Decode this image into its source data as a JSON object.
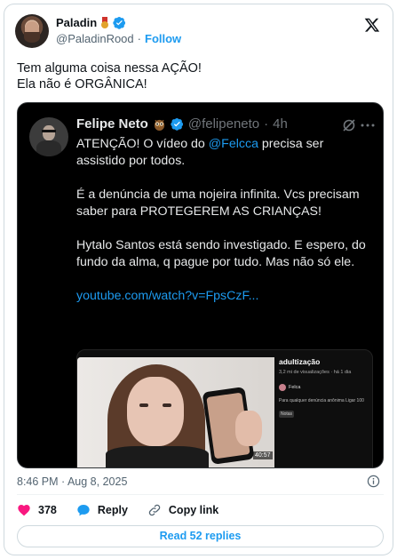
{
  "author": {
    "name": "Paladin",
    "handle": "@PaladinRood",
    "separator": "·",
    "follow_label": "Follow"
  },
  "tweet": {
    "line1": "Tem alguma coisa nessa AÇÃO!",
    "line2": "Ela não é ORGÂNICA!"
  },
  "quoted": {
    "name": "Felipe Neto",
    "handle": "@felipeneto",
    "separator": "·",
    "age": "4h",
    "p1_prefix": "ATENÇÃO! O vídeo do ",
    "p1_mention": "@Felcca",
    "p1_suffix": " precisa ser assistido por todos.",
    "p2": "É a denúncia de uma nojeira infinita. Vcs precisam saber para PROTEGEREM AS CRIANÇAS!",
    "p3": "Hytalo Santos está sendo investigado. E espero, do fundo da alma, q pague por tudo. Mas não só ele.",
    "link": "youtube.com/watch?v=FpsCzF...",
    "video": {
      "duration": "40:57",
      "title": "adultização",
      "views": "3,2 mi de visualizações · há 1 dia",
      "channel": "Felca",
      "description": "Para qualquer denúncia anônima Ligar 100",
      "tag": "Notas",
      "progress": 1.0
    }
  },
  "timestamp": "8:46 PM · Aug 8, 2025",
  "actions": {
    "likes": "378",
    "reply_label": "Reply",
    "copy_label": "Copy link"
  },
  "read_replies": "Read 52 replies",
  "colors": {
    "accent": "#1d9bf0",
    "like": "#f91880",
    "quote_bg": "#000000"
  }
}
